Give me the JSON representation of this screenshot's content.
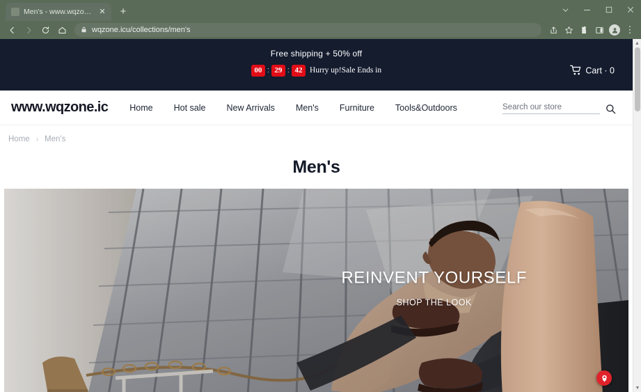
{
  "browser": {
    "tab": {
      "title": "Men's - www.wqzone.icu",
      "close_label": "✕",
      "favicon_name": "site-favicon"
    },
    "new_tab_label": "+",
    "window_controls": {
      "tab_search": "⌄",
      "minimize": "—",
      "maximize": "▢",
      "close": "✕"
    },
    "toolbar": {
      "back": "←",
      "forward": "→",
      "reload": "⟳",
      "home": "⌂",
      "url": "wqzone.icu/collections/men's",
      "lock_label": "🔒",
      "share": "share-icon",
      "bookmark": "star-icon",
      "extensions": "puzzle-icon",
      "sidepanel": "sidepanel-icon",
      "profile": "profile-icon",
      "menu": "⋮"
    }
  },
  "announcement": {
    "message": "Free shipping + 50% off",
    "countdown": {
      "hours": "00",
      "minutes": "29",
      "seconds": "42",
      "separator": ":"
    },
    "countdown_text": "Hurry up!Sale Ends in",
    "cart_label": "Cart · 0"
  },
  "header": {
    "logo": "www.wqzone.ic",
    "nav": [
      {
        "label": "Home"
      },
      {
        "label": "Hot sale"
      },
      {
        "label": "New Arrivals"
      },
      {
        "label": "Men's"
      },
      {
        "label": "Furniture"
      },
      {
        "label": "Tools&Outdoors"
      }
    ],
    "search_placeholder": "Search our store",
    "search_value": ""
  },
  "breadcrumb": {
    "home": "Home",
    "separator": "›",
    "current": "Men's"
  },
  "collection": {
    "title": "Men's"
  },
  "hero": {
    "headline": "REINVENT YOURSELF",
    "subline": "SHOP THE LOOK",
    "alt": "Man in tan turtleneck and dark jeans leaning against a glass building"
  },
  "chat_widget": {
    "name": "chat-support-badge"
  },
  "colors": {
    "chrome": "#5a6b58",
    "banner": "#141c2e",
    "countdown_red": "#e20d17",
    "text_dark": "#141928",
    "chat_red": "#e0232b"
  }
}
